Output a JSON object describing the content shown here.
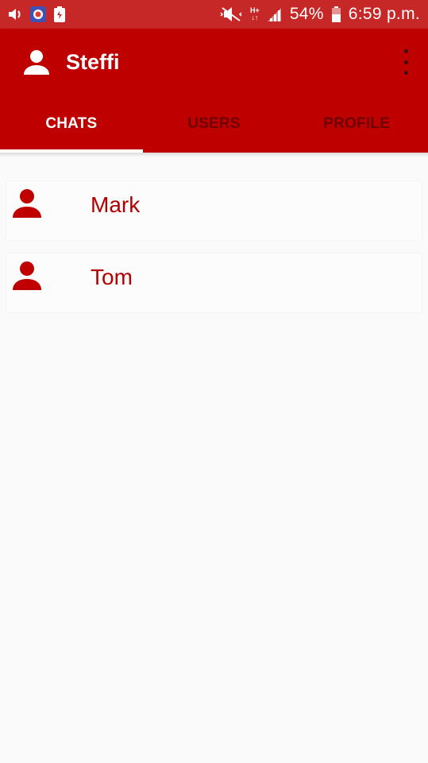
{
  "status_bar": {
    "battery": "54%",
    "time": "6:59 p.m.",
    "network": "H+",
    "icons": [
      "volume-icon",
      "app-notification-icon",
      "battery-saver-icon",
      "mute-icon",
      "signal-icon",
      "battery-icon"
    ]
  },
  "app_bar": {
    "title": "Steffi",
    "avatar_icon": "person-icon",
    "menu_icon": "more-vert-icon"
  },
  "tabs": [
    {
      "label": "CHATS",
      "active": true
    },
    {
      "label": "USERS",
      "active": false
    },
    {
      "label": "PROFILE",
      "active": false
    }
  ],
  "chats": [
    {
      "name": "Mark",
      "icon": "person-icon"
    },
    {
      "name": "Tom",
      "icon": "person-icon"
    }
  ],
  "colors": {
    "primary": "#bf0000",
    "status_bar": "#c62828",
    "accent_text": "#b00000",
    "inactive_tab": "#6d0000",
    "background": "#fafafa"
  }
}
